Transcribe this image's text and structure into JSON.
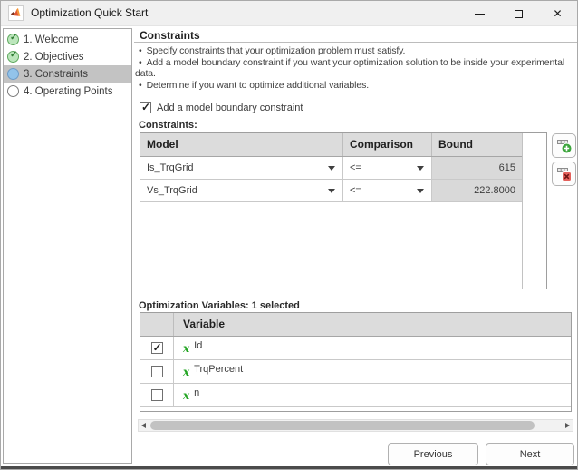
{
  "window": {
    "title": "Optimization Quick Start",
    "app_icon": "matlab-logo",
    "controls": {
      "close_glyph": "✕"
    }
  },
  "sidebar": {
    "steps": [
      {
        "label": "1. Welcome",
        "state": "complete"
      },
      {
        "label": "2. Objectives",
        "state": "complete"
      },
      {
        "label": "3. Constraints",
        "state": "current"
      },
      {
        "label": "4. Operating Points",
        "state": "pending"
      }
    ]
  },
  "main": {
    "heading": "Constraints",
    "bullet_char": "•",
    "bullets": [
      "Specify constraints that your optimization problem must satisfy.",
      "Add a model boundary constraint if you want your optimization solution to be inside your experimental data.",
      "Determine if you want to optimize additional variables."
    ],
    "boundary_checkbox": {
      "label": "Add a model boundary constraint",
      "checked": true
    },
    "constraints_table": {
      "label": "Constraints:",
      "columns": [
        "Model",
        "Comparison",
        "Bound"
      ],
      "rows": [
        {
          "model": "Is_TrqGrid",
          "comparison": "<=",
          "bound": "615"
        },
        {
          "model": "Vs_TrqGrid",
          "comparison": "<=",
          "bound": "222.8000"
        }
      ]
    },
    "variables_table": {
      "label": "Optimization Variables: 1 selected",
      "columns": [
        "",
        "Variable"
      ],
      "icon_glyph": "x",
      "rows": [
        {
          "name": "Id",
          "checked": true
        },
        {
          "name": "TrqPercent",
          "checked": false
        },
        {
          "name": "n",
          "checked": false
        }
      ]
    },
    "footer": {
      "previous_label": "Previous",
      "next_label": "Next"
    }
  },
  "colors": {
    "step_complete_fill": "#bce6bc",
    "step_current_fill": "#92c3ea",
    "selection_gray": "#c3c3c3",
    "table_header_gray": "#dcdcdc",
    "readonly_cell_gray": "#d9d9d9",
    "add_green": "#3da53d",
    "delete_red": "#e4615c"
  }
}
